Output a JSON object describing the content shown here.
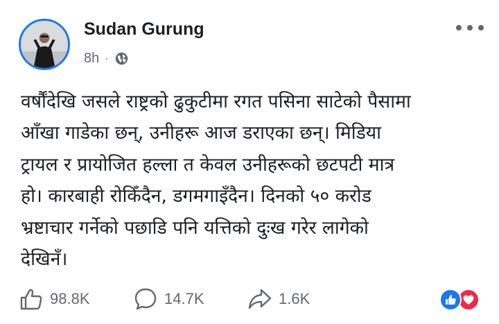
{
  "author": {
    "name": "Sudan Gurung",
    "time": "8h",
    "separator": "·"
  },
  "icons": {
    "avatar": "profile-photo",
    "privacy": "globe-icon",
    "menu": "more-dots-icon",
    "like": "thumbs-up-icon",
    "comment": "comment-bubble-icon",
    "share": "share-arrow-icon"
  },
  "post": {
    "lines": [
      "वर्षौंदेखि जसले राष्ट्रको ढुकुटीमा रगत पसिना साटेको पैसामा",
      "आँखा गाडेका छन्, उनीहरू आज डराएका छन्। मिडिया",
      "ट्रायल र प्रायोजित हल्ला त केवल उनीहरूको छटपटी मात्र",
      "हो। कारबाही रोकिँदैन, डगमगाइँदैन। दिनको ५० करोड",
      "भ्रष्टाचार गर्नेको पछाडि पनि यत्तिको दुःख गरेर लागेको",
      "देखिनँ।"
    ]
  },
  "stats": {
    "likes": "98.8K",
    "comments": "14.7K",
    "shares": "1.6K"
  },
  "colors": {
    "accent": "#1877f2",
    "love": "#f02849",
    "secondary_text": "#65676b"
  }
}
